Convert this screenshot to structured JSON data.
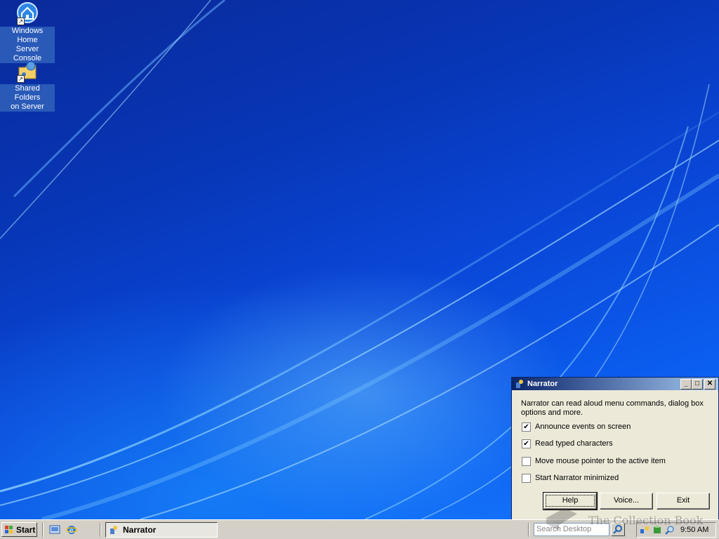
{
  "desktop": {
    "icons": [
      {
        "label_line1": "Windows Home",
        "label_line2": "Server Console",
        "icon": "home-server-icon"
      },
      {
        "label_line1": "Shared Folders",
        "label_line2": "on Server",
        "icon": "shared-folders-icon"
      }
    ]
  },
  "narrator": {
    "title": "Narrator",
    "description": "Narrator can read aloud menu commands, dialog box options and more.",
    "options": [
      {
        "label": "Announce events on screen",
        "checked": true
      },
      {
        "label": "Read typed characters",
        "checked": true
      },
      {
        "label": "Move mouse pointer to the active item",
        "checked": false
      },
      {
        "label": "Start Narrator minimized",
        "checked": false
      }
    ],
    "buttons": {
      "help": "Help",
      "voice": "Voice...",
      "exit": "Exit"
    },
    "controls": {
      "minimize": "_",
      "maximize": "□",
      "close": "✕"
    }
  },
  "taskbar": {
    "start_label": "Start",
    "task_button_label": "Narrator",
    "search_placeholder": "Search Desktop",
    "clock": "9:50 AM"
  },
  "watermark": {
    "text": "The Collection Book"
  },
  "colors": {
    "title_active_start": "#0a246a",
    "title_active_end": "#a6caf0",
    "face": "#d4d0c8"
  }
}
